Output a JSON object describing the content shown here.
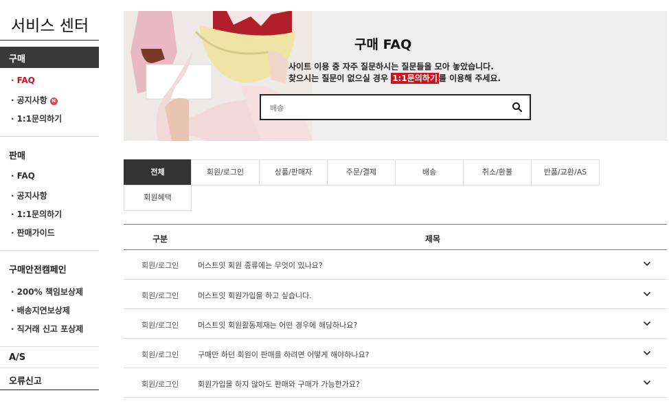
{
  "sidebar": {
    "title": "서비스 센터",
    "sections": [
      {
        "label": "구매",
        "items": [
          {
            "label": "FAQ"
          },
          {
            "label": "공지사항",
            "badge": "N"
          },
          {
            "label": "1:1문의하기"
          }
        ]
      },
      {
        "label": "판매",
        "items": [
          {
            "label": "FAQ"
          },
          {
            "label": "공지사항"
          },
          {
            "label": "1:1문의하기"
          },
          {
            "label": "판매가이드"
          }
        ]
      },
      {
        "label": "구매안전캠페인",
        "items": [
          {
            "label": "200% 책임보상제"
          },
          {
            "label": "배송지연보상제"
          },
          {
            "label": "직거래 신고 포상제"
          }
        ]
      },
      {
        "label": "A/S",
        "items": []
      },
      {
        "label": "오류신고",
        "items": []
      }
    ],
    "bullet": "·"
  },
  "banner": {
    "title": "구매 FAQ",
    "line1": "사이트 이용 중 자주 질문하시는 질문들을 모아 놓았습니다.",
    "line2_pre": "찾으시는 질문이 없으실 경우 ",
    "line2_highlight": "1:1문의하기",
    "line2_post": "를 이용해 주세요.",
    "search_placeholder": "배송"
  },
  "tabs": [
    {
      "label": "전체",
      "active": true
    },
    {
      "label": "회원/로그인"
    },
    {
      "label": "상품/판매자"
    },
    {
      "label": "주문/결제"
    },
    {
      "label": "배송"
    },
    {
      "label": "취소/환불"
    },
    {
      "label": "반품/교환/AS"
    },
    {
      "label": "회원혜택"
    }
  ],
  "table": {
    "headers": [
      "구분",
      "제목"
    ],
    "rows": [
      {
        "category": "회원/로그인",
        "title": "머스트잇 회원 종류에는 무엇이 있나요?"
      },
      {
        "category": "회원/로그인",
        "title": "머스트잇 회원가입을 하고 싶습니다."
      },
      {
        "category": "회원/로그인",
        "title": "머스트잇 회원활동제재는 어떤 경우에 해당하나요?"
      },
      {
        "category": "회원/로그인",
        "title": "구매만 하던 회원이 판매를 하려면 어떻게 해야하나요?"
      },
      {
        "category": "회원/로그인",
        "title": "회원가입을 하지 않아도 판매와 구매가 가능한가요?"
      }
    ]
  },
  "colors": {
    "accent": "#d0121b",
    "dark": "#333333"
  },
  "icons": {
    "search": "search-icon",
    "expand": "chevron-down-icon",
    "new": "new-badge-icon"
  }
}
